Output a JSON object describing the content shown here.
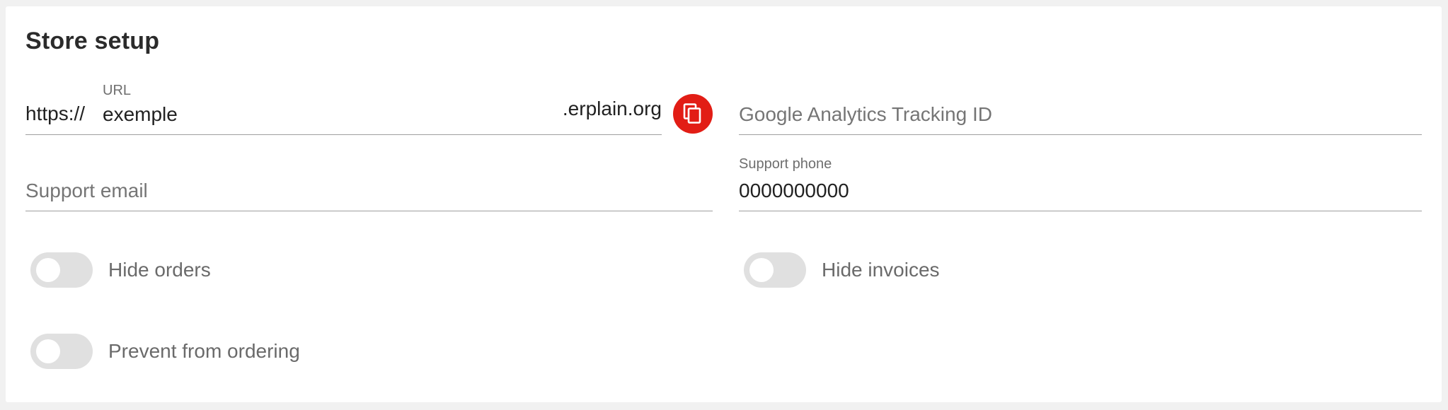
{
  "card": {
    "title": "Store setup"
  },
  "url_field": {
    "label": "URL",
    "prefix": "https://",
    "value": "exemple",
    "suffix": ".erplain.org",
    "copy_icon": "copy-icon"
  },
  "analytics_field": {
    "placeholder": "Google Analytics Tracking ID"
  },
  "email_field": {
    "placeholder": "Support email"
  },
  "phone_field": {
    "label": "Support phone",
    "value": "0000000000"
  },
  "toggles": {
    "hide_orders": {
      "label": "Hide orders",
      "on": false
    },
    "hide_invoices": {
      "label": "Hide invoices",
      "on": false
    },
    "prevent_ordering": {
      "label": "Prevent from ordering",
      "on": false
    }
  },
  "colors": {
    "accent": "#e21d15",
    "toggle_track": "#e0e0e0",
    "underline": "#9e9e9e"
  }
}
